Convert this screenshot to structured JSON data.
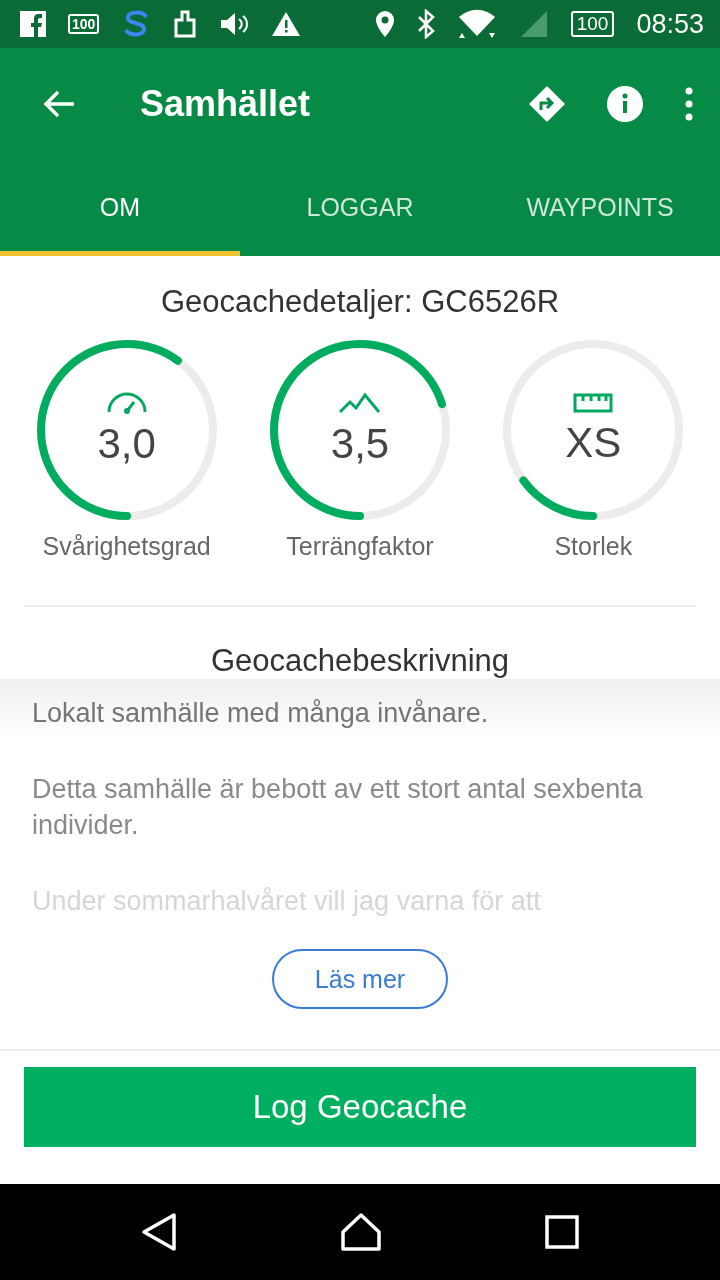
{
  "status_bar": {
    "battery_badge": "100",
    "battery": "100",
    "time": "08:53"
  },
  "app_bar": {
    "title": "Samhället"
  },
  "tabs": [
    {
      "label": "OM",
      "selected": true
    },
    {
      "label": "LOGGAR",
      "selected": false
    },
    {
      "label": "WAYPOINTS",
      "selected": false
    }
  ],
  "details": {
    "title": "Geocachedetaljer: GC6526R",
    "gauges": [
      {
        "kind": "difficulty",
        "value": "3,0",
        "label": "Svårighetsgrad",
        "level": 0.6
      },
      {
        "kind": "terrain",
        "value": "3,5",
        "label": "Terrängfaktor",
        "level": 0.7
      },
      {
        "kind": "size",
        "value": "XS",
        "label": "Storlek",
        "level": 0.15
      }
    ]
  },
  "description": {
    "title": "Geocachebeskrivning",
    "paragraphs": [
      "Lokalt samhälle med många invånare.",
      "Detta samhälle är bebott av ett stort antal sexbenta individer.",
      "Under sommarhalvåret vill jag varna för att"
    ],
    "more_button": "Läs mer"
  },
  "log_button": "Log Geocache"
}
